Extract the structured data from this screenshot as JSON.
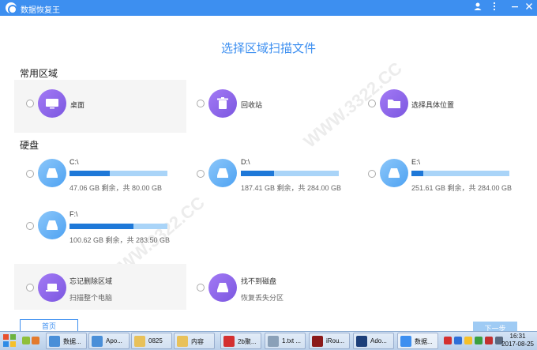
{
  "window": {
    "title": "数据恢复王"
  },
  "heading": "选择区域扫描文件",
  "common": {
    "title": "常用区域",
    "items": [
      {
        "label": "桌面"
      },
      {
        "label": "回收站"
      },
      {
        "label": "选择具体位置"
      }
    ]
  },
  "disks": {
    "title": "硬盘",
    "items": [
      {
        "label": "C:\\",
        "info": "47.06 GB 剩余，共 80.00 GB",
        "used_fraction": 0.41
      },
      {
        "label": "D:\\",
        "info": "187.41 GB 剩余，共 284.00 GB",
        "used_fraction": 0.34
      },
      {
        "label": "E:\\",
        "info": "251.61 GB 剩余，共 284.00 GB",
        "used_fraction": 0.12
      },
      {
        "label": "F:\\",
        "info": "100.62 GB 剩余，共 283.50 GB",
        "used_fraction": 0.65
      }
    ]
  },
  "extra": {
    "items": [
      {
        "label": "忘记删除区域",
        "sub": "扫描整个电脑"
      },
      {
        "label": "找不到磁盘",
        "sub": "恢复丢失分区"
      }
    ]
  },
  "buttons": {
    "home": "首页",
    "next": "下一步"
  },
  "taskbar": {
    "tasks": [
      {
        "label": "数据...",
        "color": "#4a8fd8"
      },
      {
        "label": "Apo...",
        "color": "#4a8fd8"
      },
      {
        "label": "0825",
        "color": "#e8c15a"
      },
      {
        "label": "内容",
        "color": "#e8c15a"
      },
      {
        "label": "2b聚...",
        "color": "#d43030"
      },
      {
        "label": "1.txt ...",
        "color": "#8aa0b8"
      },
      {
        "label": "iRou...",
        "color": "#8b1a1a"
      },
      {
        "label": "Ado...",
        "color": "#1c3f7a"
      },
      {
        "label": "数据...",
        "color": "#3d8ff0"
      }
    ],
    "time": "16:31",
    "date": "2017-08-25"
  },
  "colors": {
    "accent": "#3d8ff0",
    "bar_fill": "#1e78d8",
    "bar_track": "#a9d4f8"
  }
}
